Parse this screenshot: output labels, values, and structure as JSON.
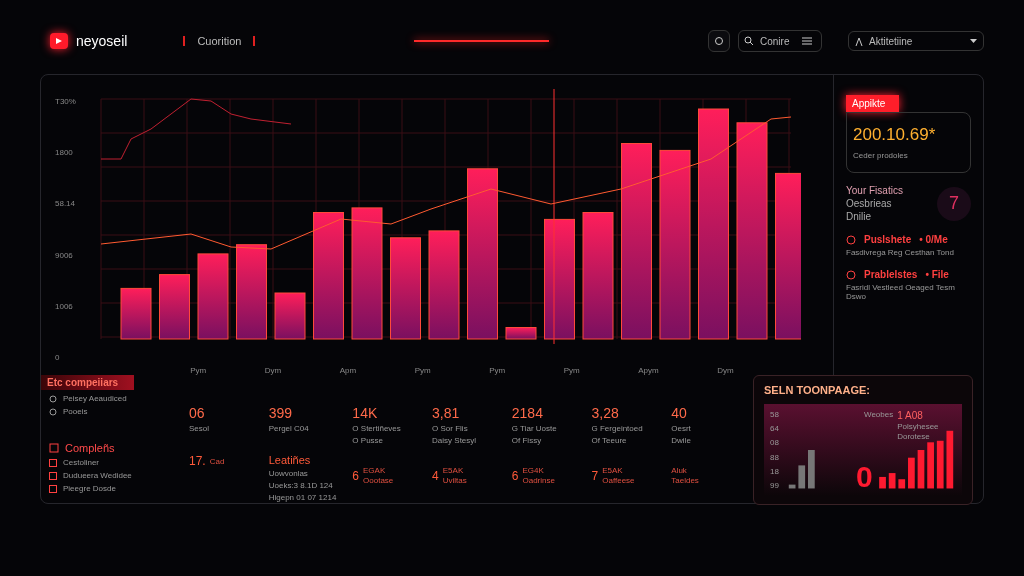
{
  "header": {
    "brand": "neyoseil",
    "nav_label": "Cuorition",
    "search": {
      "value": "Conire"
    },
    "dropdown": {
      "value": "Aktitetiine"
    }
  },
  "main_chart": {
    "y_labels": [
      "T30%",
      "1800",
      "58.14",
      "9006",
      "1006",
      "0"
    ],
    "x_labels": [
      "Pym",
      "Dym",
      "Apm",
      "Pym",
      "Pym",
      "Pym",
      "Apym",
      "Dym"
    ]
  },
  "sidebar": {
    "badge": "Appikte",
    "value": "200.10.69*",
    "caption": "Ceder prodoles",
    "profile_lines": [
      "Your Fisatics",
      "Oesbrieas",
      "Dnilie"
    ],
    "profile_count": "7",
    "items": [
      {
        "title": "Puslshete",
        "tag": "• 0/Me",
        "desc": "Fasdivrega Reg Cesthan Tond"
      },
      {
        "title": "Prablelstes",
        "tag": "• File",
        "desc": "Fasridl Vestleed Oeaged Tesm Dswo"
      }
    ]
  },
  "left_list": {
    "badge": "Etc compeiiars",
    "items": [
      "Peisey Aeaudiced",
      "Pooeis"
    ],
    "section_title": "Compleñs",
    "section_items": [
      "Cestoliner",
      "Dudueera Wedidee",
      "Pieegre Dosde"
    ]
  },
  "stats": [
    {
      "value": "06",
      "lines": [
        "Sesol"
      ],
      "lower_value": "17.",
      "lower_lines": [
        "Cad"
      ]
    },
    {
      "value": "399",
      "lines": [
        "Pergel C04"
      ],
      "lower_title": "Leatiñes",
      "lower_lines": [
        "Uowvonlas",
        "Uoeks:3 8.1D 124",
        "Higepn 01 07 1214"
      ]
    },
    {
      "value": "14K",
      "lines": [
        "O Stertiñeves",
        "O Pusse"
      ],
      "lower_value": "6",
      "lower_lines": [
        "EGAK",
        "Oootase"
      ]
    },
    {
      "value": "3,81",
      "lines": [
        "O Sor Flis",
        "Daisy Stesyl"
      ],
      "lower_value": "4",
      "lower_lines": [
        "E5AK",
        "Uviltas"
      ]
    },
    {
      "value": "2184",
      "lines": [
        "G Tiar Uoste",
        "Of Fissy"
      ],
      "lower_value": "6",
      "lower_lines": [
        "EG4K",
        "Oadrinse"
      ]
    },
    {
      "value": "3,28",
      "lines": [
        "G Fergeintoed",
        "Of Teeure"
      ],
      "lower_value": "7",
      "lower_lines": [
        "E5AK",
        "Oaffeese"
      ]
    },
    {
      "value": "40",
      "lines": [
        "Oesrt",
        "Dwile"
      ],
      "lower_lines": [
        "Aluk",
        "Taeldes"
      ]
    }
  ],
  "summary_card": {
    "title": "SELN TOONPAAGE:",
    "y_labels": [
      "58",
      "64",
      "08",
      "88",
      "18",
      "99"
    ],
    "figure": "1 A08",
    "note_label": "Weobes",
    "note_lines": [
      "Polsyhesee",
      "Dorotese"
    ],
    "big_value": "0"
  }
}
